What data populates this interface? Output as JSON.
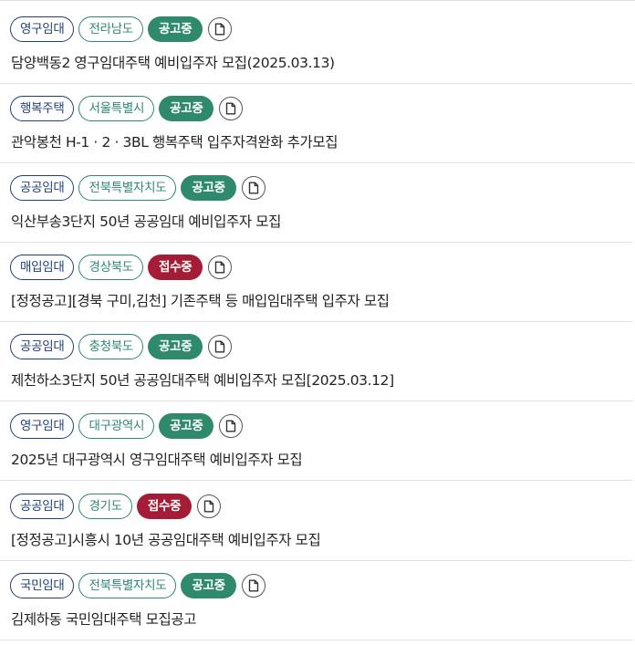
{
  "colors": {
    "type_tag": "#1f3f7a",
    "region_tag": "#2e8778",
    "status_open": "#2f8a6d",
    "status_receiving": "#a51c36",
    "divider": "#e2e2e2"
  },
  "notices": [
    {
      "type": "영구임대",
      "region": "전라남도",
      "status": "공고중",
      "status_color": "green",
      "icon": "document-icon",
      "title": "담양백동2 영구임대주택 예비입주자 모집(2025.03.13)"
    },
    {
      "type": "행복주택",
      "region": "서울특별시",
      "status": "공고중",
      "status_color": "green",
      "icon": "document-icon",
      "title": "관악봉천 H-1 · 2 · 3BL 행복주택 입주자격완화 추가모집"
    },
    {
      "type": "공공임대",
      "region": "전북특별자치도",
      "status": "공고중",
      "status_color": "green",
      "icon": "document-icon",
      "title": "익산부송3단지 50년 공공임대 예비입주자 모집"
    },
    {
      "type": "매입임대",
      "region": "경상북도",
      "status": "접수중",
      "status_color": "red",
      "icon": "document-icon",
      "title": "[정정공고][경북 구미,김천] 기존주택 등 매입임대주택 입주자 모집"
    },
    {
      "type": "공공임대",
      "region": "충청북도",
      "status": "공고중",
      "status_color": "green",
      "icon": "document-icon",
      "title": "제천하소3단지 50년 공공임대주택 예비입주자 모집[2025.03.12]"
    },
    {
      "type": "영구임대",
      "region": "대구광역시",
      "status": "공고중",
      "status_color": "green",
      "icon": "document-icon",
      "title": "2025년 대구광역시 영구임대주택 예비입주자 모집"
    },
    {
      "type": "공공임대",
      "region": "경기도",
      "status": "접수중",
      "status_color": "red",
      "icon": "document-icon",
      "title": "[정정공고]시흥시 10년 공공임대주택 예비입주자 모집"
    },
    {
      "type": "국민임대",
      "region": "전북특별자치도",
      "status": "공고중",
      "status_color": "green",
      "icon": "document-icon",
      "title": "김제하동 국민임대주택 모집공고"
    }
  ]
}
